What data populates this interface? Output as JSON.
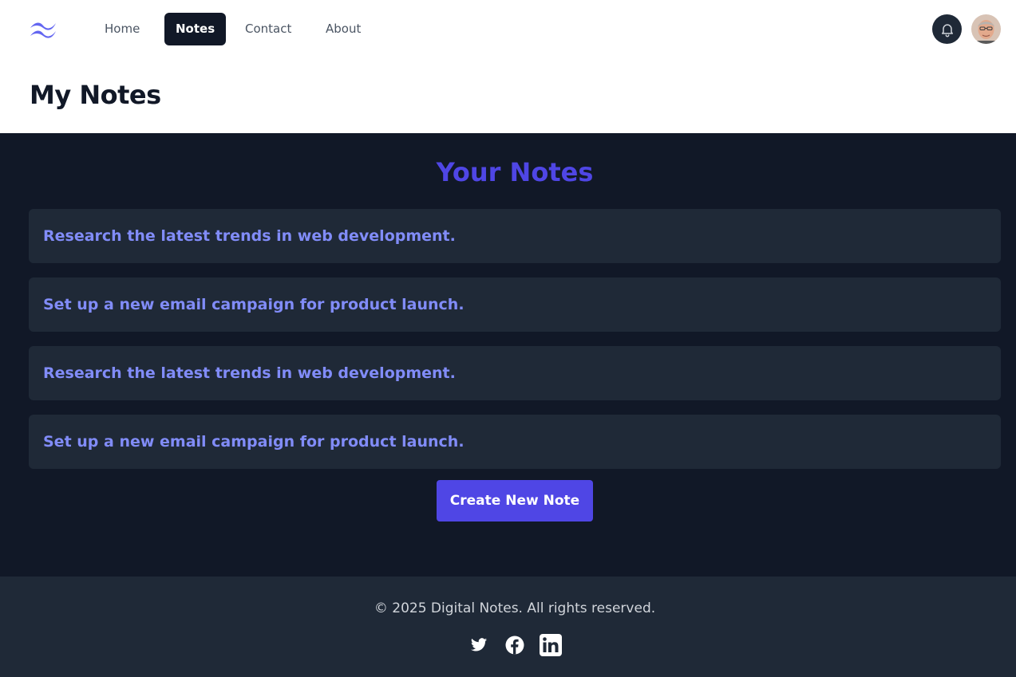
{
  "nav": {
    "logo_icon": "tailwind-wave-logo",
    "links": [
      {
        "label": "Home",
        "active": false
      },
      {
        "label": "Notes",
        "active": true
      },
      {
        "label": "Contact",
        "active": false
      },
      {
        "label": "About",
        "active": false
      }
    ],
    "notification_icon": "bell-icon",
    "avatar_icon": "user-avatar"
  },
  "page": {
    "title": "My Notes"
  },
  "notes_section": {
    "title": "Your Notes",
    "notes": [
      "Research the latest trends in web development.",
      "Set up a new email campaign for product launch.",
      "Research the latest trends in web development.",
      "Set up a new email campaign for product launch."
    ],
    "create_button": "Create New Note"
  },
  "footer": {
    "copyright": "© 2025 Digital Notes. All rights reserved.",
    "social_icons": [
      "twitter-icon",
      "facebook-icon",
      "linkedin-icon"
    ]
  },
  "colors": {
    "accent": "#4f46e5",
    "note_text": "#818cf8",
    "dark_bg": "#111827",
    "card_bg": "#1f2937"
  }
}
